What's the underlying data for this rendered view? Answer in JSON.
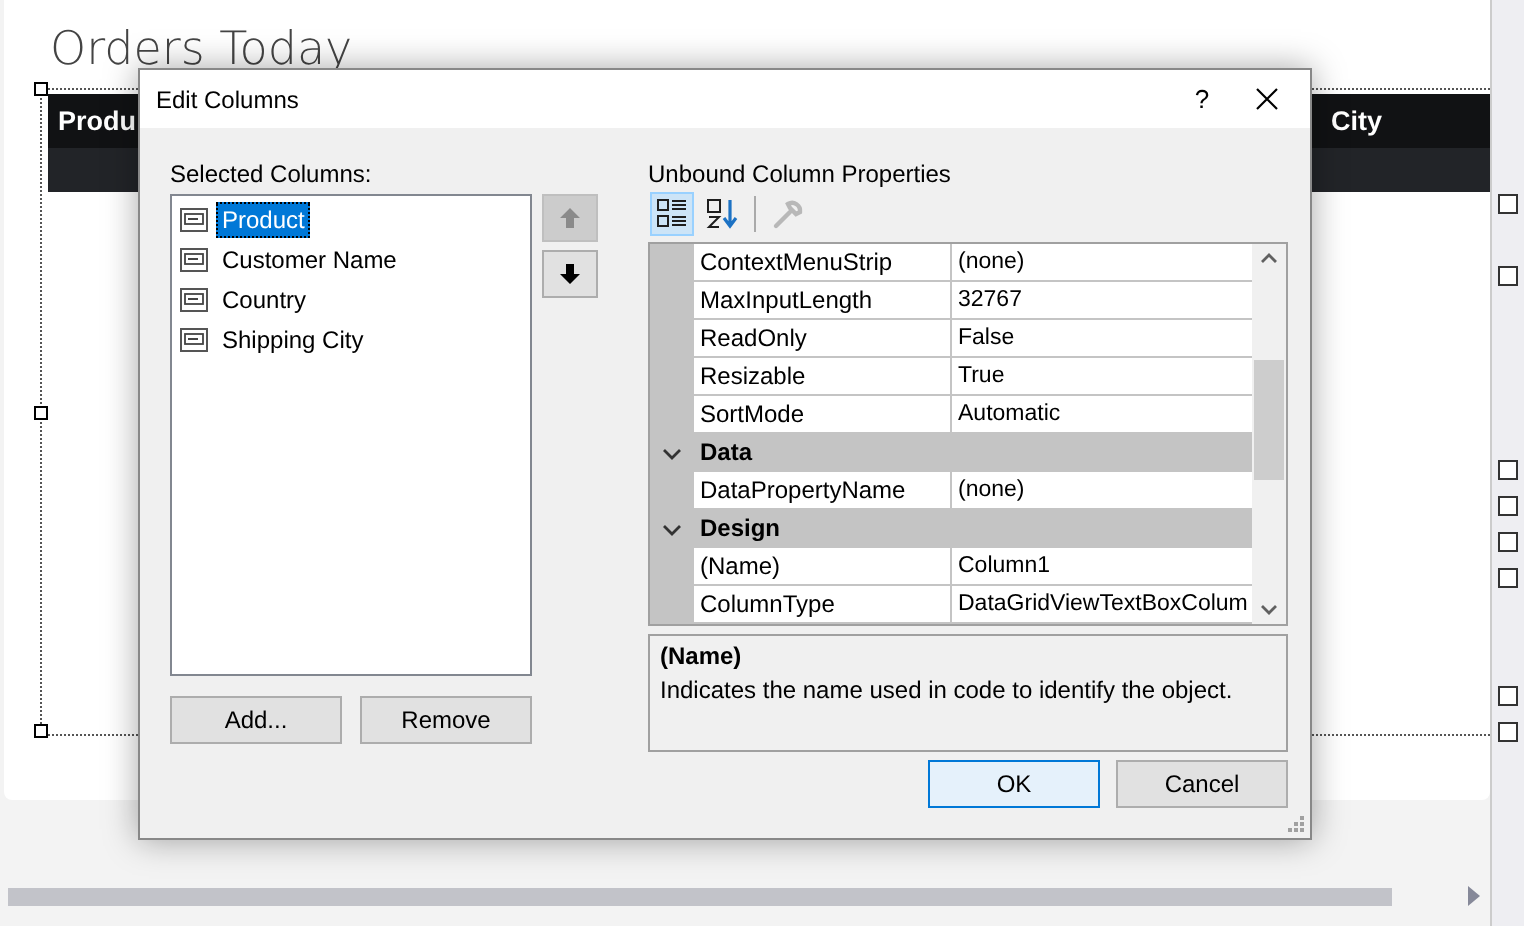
{
  "designer": {
    "title": "Orders Today",
    "grid_headers": [
      "Produ",
      "City"
    ]
  },
  "dialog": {
    "title": "Edit Columns",
    "help": "?",
    "selected_columns": {
      "label": "Selected Columns:",
      "items": [
        {
          "label": "Product",
          "selected": true
        },
        {
          "label": "Customer Name",
          "selected": false
        },
        {
          "label": "Country",
          "selected": false
        },
        {
          "label": "Shipping City",
          "selected": false
        }
      ]
    },
    "move_buttons": [
      {
        "kind": "up",
        "disabled": true
      },
      {
        "kind": "down",
        "disabled": false
      }
    ],
    "list_buttons": [
      "Add...",
      "Remove"
    ],
    "properties": {
      "label": "Unbound Column Properties",
      "toolbar": [
        {
          "kind": "categorized",
          "selected": true,
          "disabled": false
        },
        {
          "kind": "alphabetical",
          "selected": false,
          "disabled": false
        },
        {
          "kind": "property-pages",
          "selected": false,
          "disabled": true
        }
      ],
      "rows": [
        {
          "kind": "property",
          "name": "ContextMenuStrip",
          "value": "(none)"
        },
        {
          "kind": "property",
          "name": "MaxInputLength",
          "value": "32767"
        },
        {
          "kind": "property",
          "name": "ReadOnly",
          "value": "False"
        },
        {
          "kind": "property",
          "name": "Resizable",
          "value": "True"
        },
        {
          "kind": "property",
          "name": "SortMode",
          "value": "Automatic"
        },
        {
          "kind": "category",
          "name": "Data",
          "expanded": true
        },
        {
          "kind": "property",
          "name": "DataPropertyName",
          "value": "(none)"
        },
        {
          "kind": "category",
          "name": "Design",
          "expanded": true
        },
        {
          "kind": "property",
          "name": "(Name)",
          "value": "Column1"
        },
        {
          "kind": "property",
          "name": "ColumnType",
          "value": "DataGridViewTextBoxColum"
        }
      ]
    },
    "description": {
      "title": "(Name)",
      "text": "Indicates the name used in code to identify the object."
    },
    "footer_buttons": [
      {
        "label": "OK",
        "default": true
      },
      {
        "label": "Cancel",
        "default": false
      }
    ]
  }
}
